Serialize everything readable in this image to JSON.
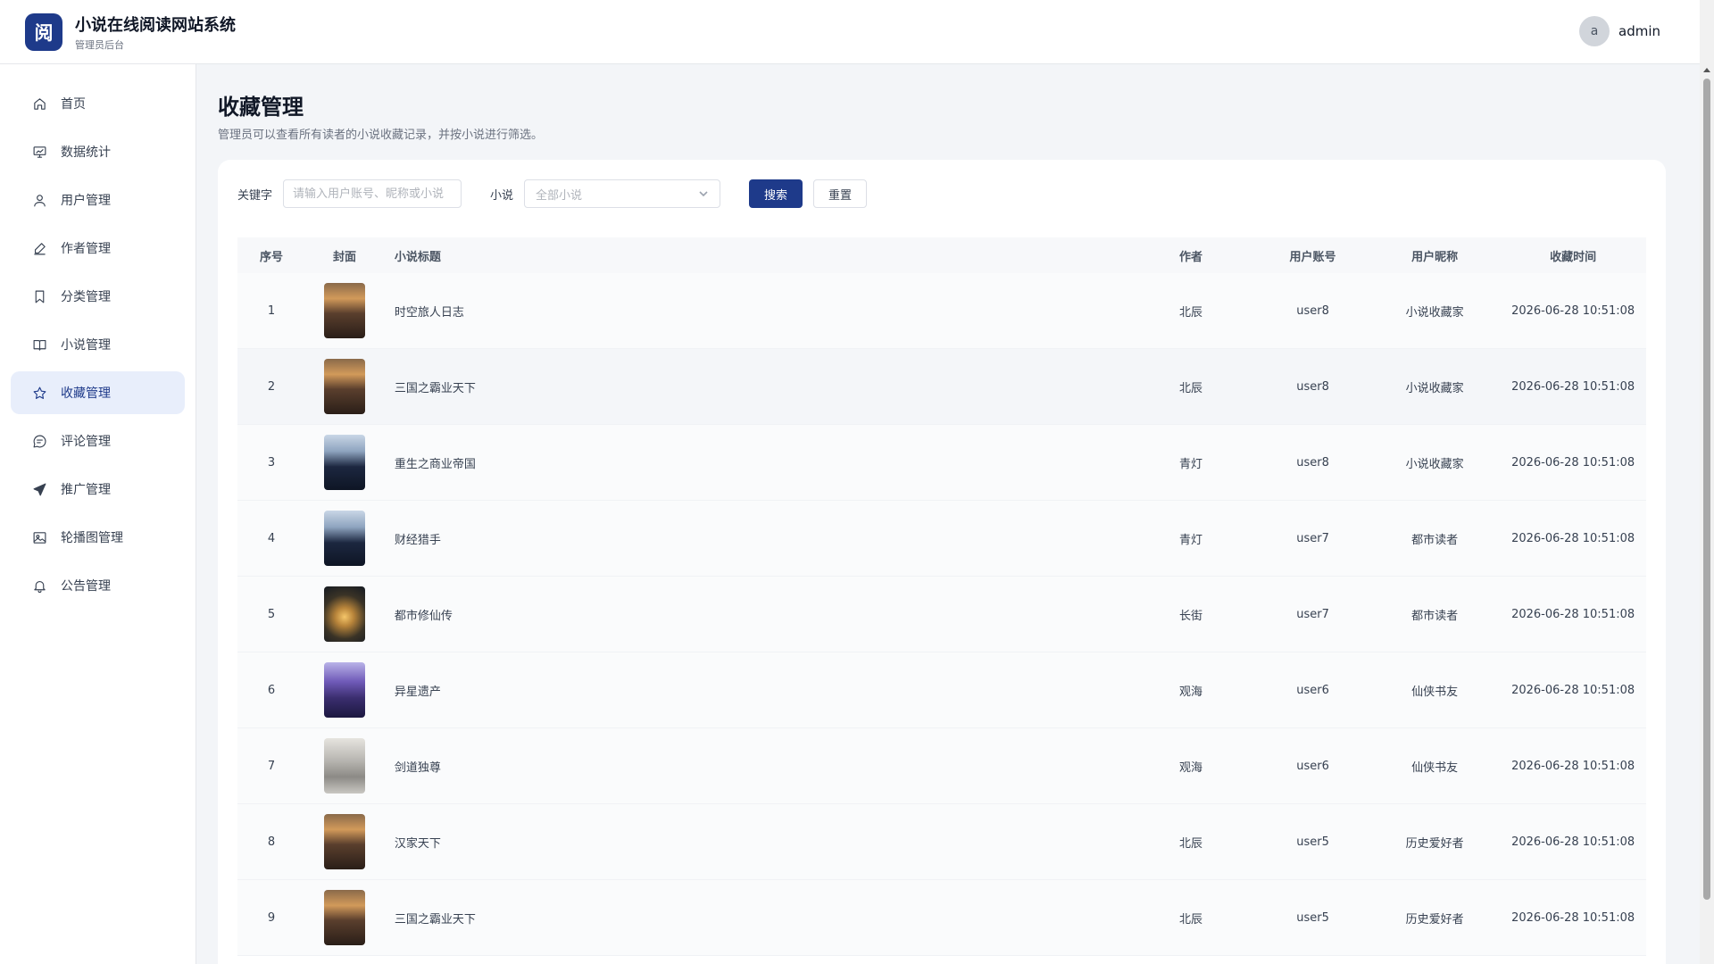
{
  "app": {
    "logo_char": "阅",
    "title": "小说在线阅读网站系统",
    "subtitle": "管理员后台",
    "user_initial": "a",
    "username": "admin",
    "accent_color": "#1e3a8a"
  },
  "sidebar": {
    "items": [
      {
        "label": "首页",
        "icon": "home-icon"
      },
      {
        "label": "数据统计",
        "icon": "chart-icon"
      },
      {
        "label": "用户管理",
        "icon": "user-icon"
      },
      {
        "label": "作者管理",
        "icon": "pen-icon"
      },
      {
        "label": "分类管理",
        "icon": "bookmark-icon"
      },
      {
        "label": "小说管理",
        "icon": "book-icon"
      },
      {
        "label": "收藏管理",
        "icon": "star-icon",
        "active": true
      },
      {
        "label": "评论管理",
        "icon": "comment-icon"
      },
      {
        "label": "推广管理",
        "icon": "send-icon"
      },
      {
        "label": "轮播图管理",
        "icon": "image-icon"
      },
      {
        "label": "公告管理",
        "icon": "bell-icon"
      }
    ]
  },
  "page": {
    "title": "收藏管理",
    "description": "管理员可以查看所有读者的小说收藏记录，并按小说进行筛选。"
  },
  "filters": {
    "keyword_label": "关键字",
    "keyword_placeholder": "请输入用户账号、昵称或小说",
    "novel_label": "小说",
    "novel_selected": "全部小说",
    "search_label": "搜索",
    "reset_label": "重置"
  },
  "table": {
    "headers": {
      "index": "序号",
      "cover": "封面",
      "title": "小说标题",
      "author": "作者",
      "account": "用户账号",
      "nickname": "用户昵称",
      "time": "收藏时间"
    },
    "rows": [
      {
        "index": "1",
        "cover": "cover-battlefield",
        "title": "时空旅人日志",
        "author": "北辰",
        "account": "user8",
        "nickname": "小说收藏家",
        "time": "2026-06-28 10:51:08"
      },
      {
        "index": "2",
        "cover": "cover-battlefield",
        "title": "三国之霸业天下",
        "author": "北辰",
        "account": "user8",
        "nickname": "小说收藏家",
        "time": "2026-06-28 10:51:08"
      },
      {
        "index": "3",
        "cover": "cover-businessman",
        "title": "重生之商业帝国",
        "author": "青灯",
        "account": "user8",
        "nickname": "小说收藏家",
        "time": "2026-06-28 10:51:08"
      },
      {
        "index": "4",
        "cover": "cover-businessman",
        "title": "财经猎手",
        "author": "青灯",
        "account": "user7",
        "nickname": "都市读者",
        "time": "2026-06-28 10:51:08"
      },
      {
        "index": "5",
        "cover": "cover-meditation",
        "title": "都市修仙传",
        "author": "长街",
        "account": "user7",
        "nickname": "都市读者",
        "time": "2026-06-28 10:51:08"
      },
      {
        "index": "6",
        "cover": "cover-sorcerer",
        "title": "异星遗产",
        "author": "观海",
        "account": "user6",
        "nickname": "仙侠书友",
        "time": "2026-06-28 10:51:08"
      },
      {
        "index": "7",
        "cover": "cover-swordsman",
        "title": "剑道独尊",
        "author": "观海",
        "account": "user6",
        "nickname": "仙侠书友",
        "time": "2026-06-28 10:51:08"
      },
      {
        "index": "8",
        "cover": "cover-battlefield",
        "title": "汉家天下",
        "author": "北辰",
        "account": "user5",
        "nickname": "历史爱好者",
        "time": "2026-06-28 10:51:08"
      },
      {
        "index": "9",
        "cover": "cover-battlefield",
        "title": "三国之霸业天下",
        "author": "北辰",
        "account": "user5",
        "nickname": "历史爱好者",
        "time": "2026-06-28 10:51:08"
      }
    ]
  }
}
